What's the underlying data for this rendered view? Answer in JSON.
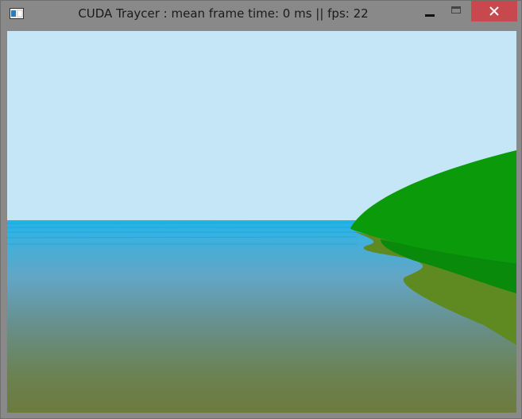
{
  "window": {
    "title": "CUDA Traycer : mean frame time: 0 ms || fps: 22",
    "icon": "app-window-icon",
    "buttons": {
      "minimize": "minimize-icon",
      "maximize": "maximize-icon",
      "close": "close-icon"
    }
  },
  "scene": {
    "sky_color": "#c4e6f7",
    "water_near_color": "#63a5c5",
    "water_far_color": "#6c7b3e",
    "terrain_color": "#0a9a0a"
  }
}
